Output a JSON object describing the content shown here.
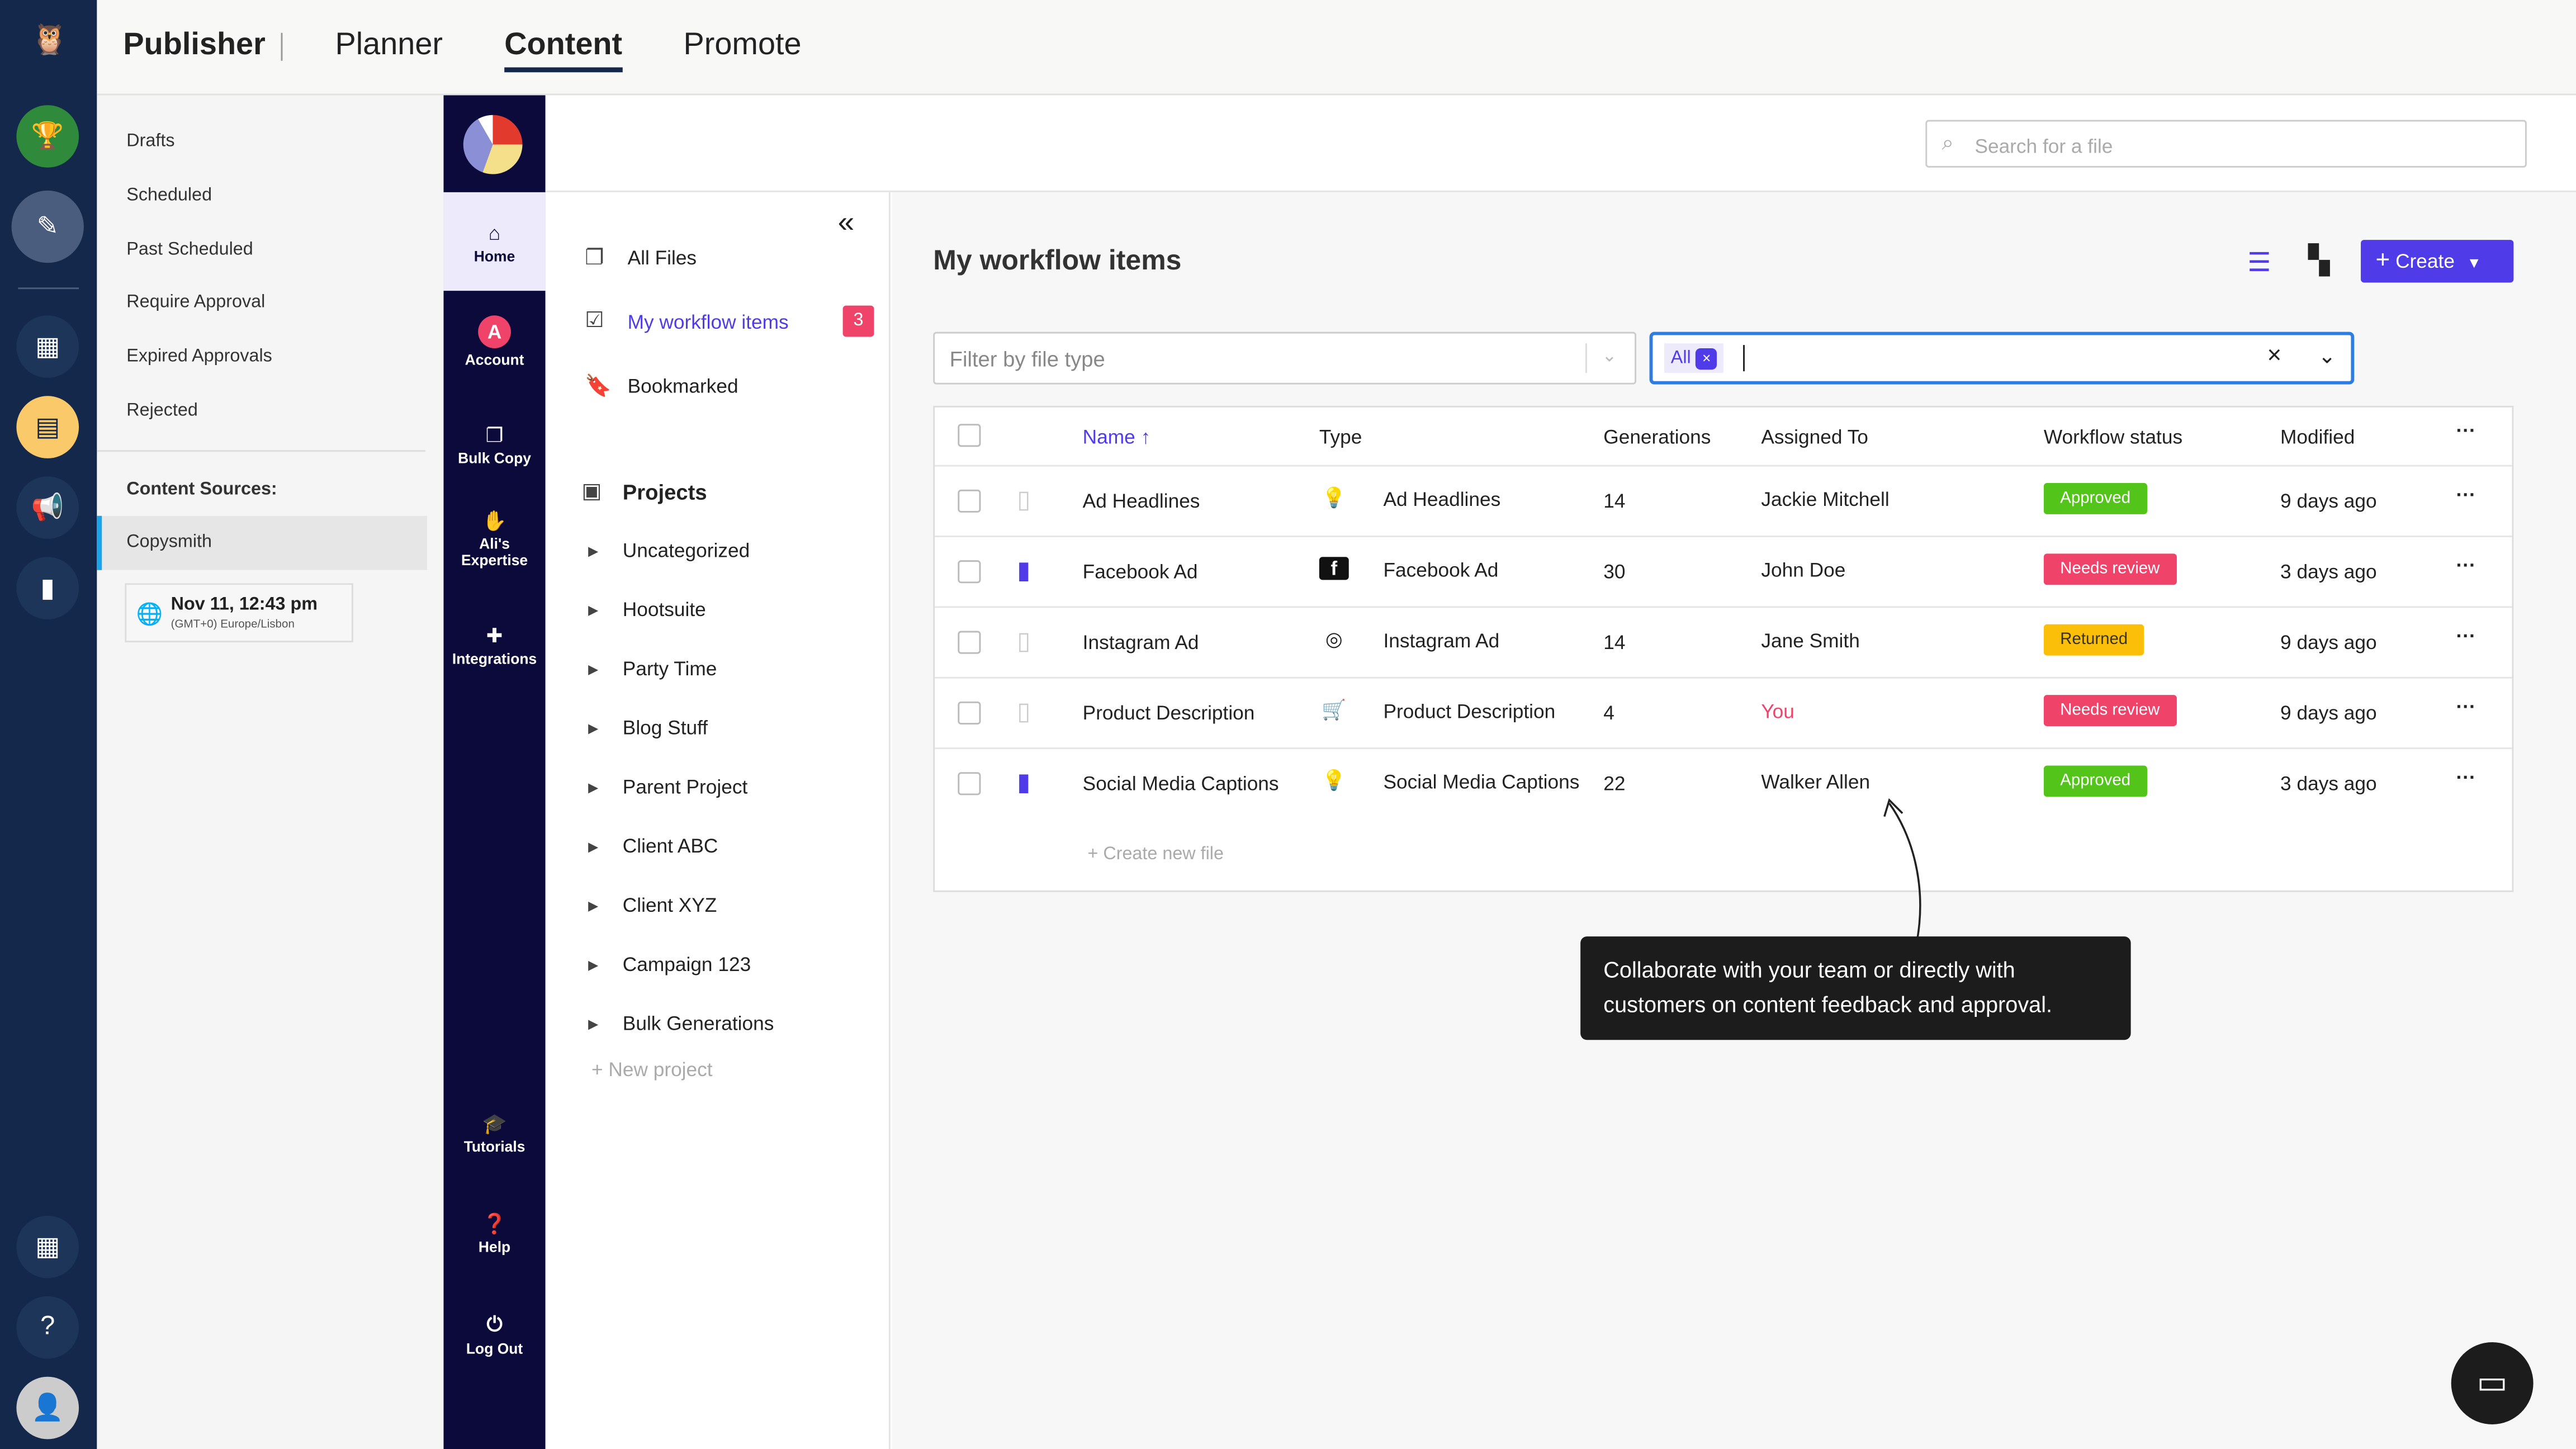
{
  "topbar": {
    "brand": "Publisher",
    "tabs": [
      "Planner",
      "Content",
      "Promote"
    ],
    "active_tab": "Content"
  },
  "left_nav": {
    "items": [
      "Drafts",
      "Scheduled",
      "Past Scheduled",
      "Require Approval",
      "Expired Approvals",
      "Rejected"
    ],
    "sources_label": "Content Sources:",
    "source": "Copysmith",
    "date": "Nov 11, 12:43 pm",
    "timezone": "(GMT+0) Europe/Lisbon"
  },
  "app_nav": {
    "items": [
      {
        "label": "Home",
        "icon": "home-icon"
      },
      {
        "label": "Account",
        "icon": "A"
      },
      {
        "label": "Bulk Copy",
        "icon": "copy-icon"
      },
      {
        "label": "Ali's Expertise",
        "icon": "hand-icon"
      },
      {
        "label": "Integrations",
        "icon": "puzzle-icon"
      },
      {
        "label": "Tutorials",
        "icon": "graduation-cap-icon"
      },
      {
        "label": "Help",
        "icon": "question-icon"
      },
      {
        "label": "Log Out",
        "icon": "power-icon"
      }
    ]
  },
  "file_nav": {
    "all_files": "All Files",
    "workflow": "My workflow items",
    "workflow_count": "3",
    "bookmarked": "Bookmarked",
    "projects_label": "Projects",
    "projects": [
      "Uncategorized",
      "Hootsuite",
      "Party Time",
      "Blog Stuff",
      "Parent Project",
      "Client ABC",
      "Client XYZ",
      "Campaign 123",
      "Bulk Generations"
    ],
    "new_project": "+ New project"
  },
  "search": {
    "placeholder": "Search for a file"
  },
  "main": {
    "title": "My workflow items",
    "create_label": "Create",
    "filter_placeholder": "Filter by file type",
    "status_chip": "All",
    "columns": [
      "Name",
      "Type",
      "Generations",
      "Assigned To",
      "Workflow status",
      "Modified"
    ],
    "rows": [
      {
        "name": "Ad Headlines",
        "bookmarked": false,
        "type_icon": "lightbulb-icon",
        "type": "Ad Headlines",
        "generations": "14",
        "assigned": "Jackie Mitchell",
        "status": "Approved",
        "modified": "9 days ago"
      },
      {
        "name": "Facebook Ad",
        "bookmarked": true,
        "type_icon": "facebook-icon",
        "type": "Facebook Ad",
        "generations": "30",
        "assigned": "John Doe",
        "status": "Needs review",
        "modified": "3 days ago"
      },
      {
        "name": "Instagram Ad",
        "bookmarked": false,
        "type_icon": "instagram-icon",
        "type": "Instagram Ad",
        "generations": "14",
        "assigned": "Jane Smith",
        "status": "Returned",
        "modified": "9 days ago"
      },
      {
        "name": "Product Description",
        "bookmarked": false,
        "type_icon": "cart-icon",
        "type": "Product Description",
        "generations": "4",
        "assigned": "You",
        "status": "Needs review",
        "modified": "9 days ago"
      },
      {
        "name": "Social Media Captions",
        "bookmarked": true,
        "type_icon": "lightbulb-icon",
        "type": "Social Media Captions",
        "generations": "22",
        "assigned": "Walker Allen",
        "status": "Approved",
        "modified": "3 days ago"
      }
    ],
    "create_new": "+ Create new file"
  },
  "status_colors": {
    "Approved": "#52c41a",
    "Needs review": "#f0436a",
    "Returned": "#fbbf0a"
  },
  "accent": "#4f3ce8",
  "tooltip": "Collaborate with your team or directly with customers on content feedback and approval."
}
